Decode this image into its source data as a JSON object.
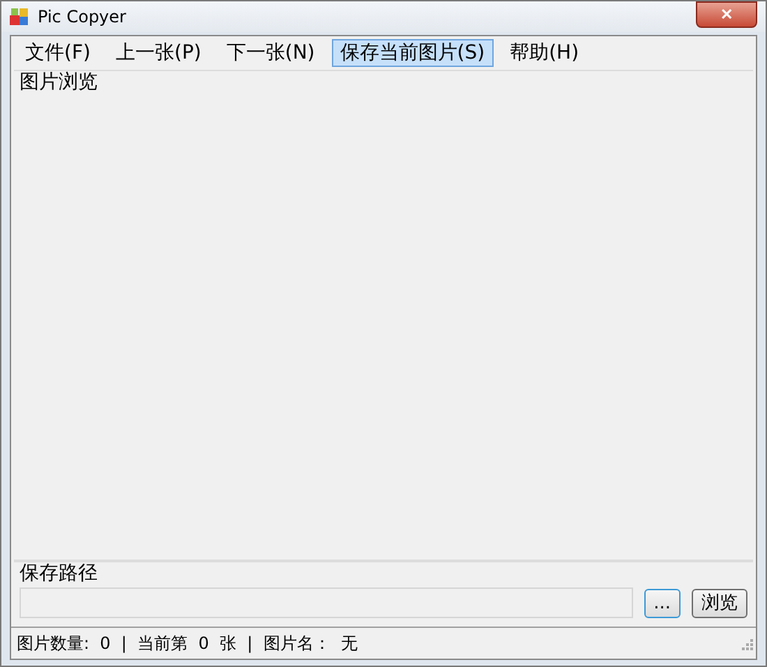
{
  "window": {
    "title": "Pic Copyer",
    "close": "✕"
  },
  "menu": [
    {
      "label": "文件(F)",
      "selected": false
    },
    {
      "label": "上一张(P)",
      "selected": false
    },
    {
      "label": "下一张(N)",
      "selected": false
    },
    {
      "label": "保存当前图片(S)",
      "selected": true
    },
    {
      "label": "帮助(H)",
      "selected": false
    }
  ],
  "preview": {
    "title": "图片浏览"
  },
  "save_path": {
    "title": "保存路径",
    "browse_dots": "...",
    "browse": "浏览"
  },
  "status_bar": {
    "text": "图片数量:  0  |  当前第  0  张  |  图片名：  无"
  }
}
